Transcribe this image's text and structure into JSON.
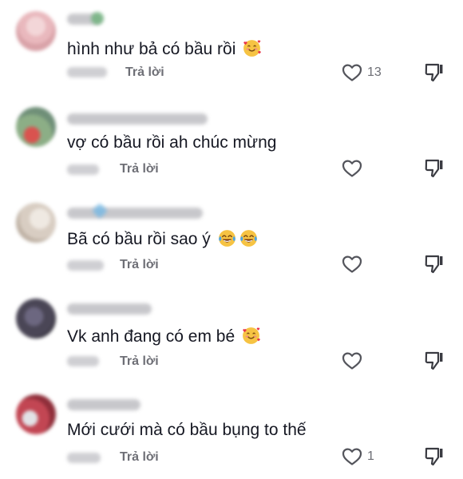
{
  "comments": [
    {
      "text": "hình như bả có bầu rồi",
      "emoji": [
        "smiling-face-with-hearts"
      ],
      "reply_label": "Trả lời",
      "like_count": "13",
      "avatar_color": "#e8c7c9"
    },
    {
      "text": "vợ có bầu rồi ah chúc mừng",
      "emoji": [],
      "reply_label": "Trả lời",
      "like_count": "",
      "avatar_color": "#7a9a7f"
    },
    {
      "text": "Bã có bầu rồi sao ý",
      "emoji": [
        "face-with-tears-of-joy",
        "face-with-tears-of-joy"
      ],
      "reply_label": "Trả lời",
      "like_count": "",
      "avatar_color": "#d7cfc6"
    },
    {
      "text": "Vk anh đang có em bé",
      "emoji": [
        "smiling-face-with-hearts"
      ],
      "reply_label": "Trả lời",
      "like_count": "",
      "avatar_color": "#4a4656"
    },
    {
      "text": "Mới cưới mà có bầu bụng to thế",
      "emoji": [],
      "reply_label": "Trả lời",
      "like_count": "1",
      "avatar_color": "#b0404c"
    }
  ],
  "colors": {
    "text": "#161823",
    "secondary": "#6e6f76",
    "emoji_yellow": "#f6c343",
    "emoji_heart": "#e8364a",
    "emoji_tear": "#4aa4e8"
  }
}
